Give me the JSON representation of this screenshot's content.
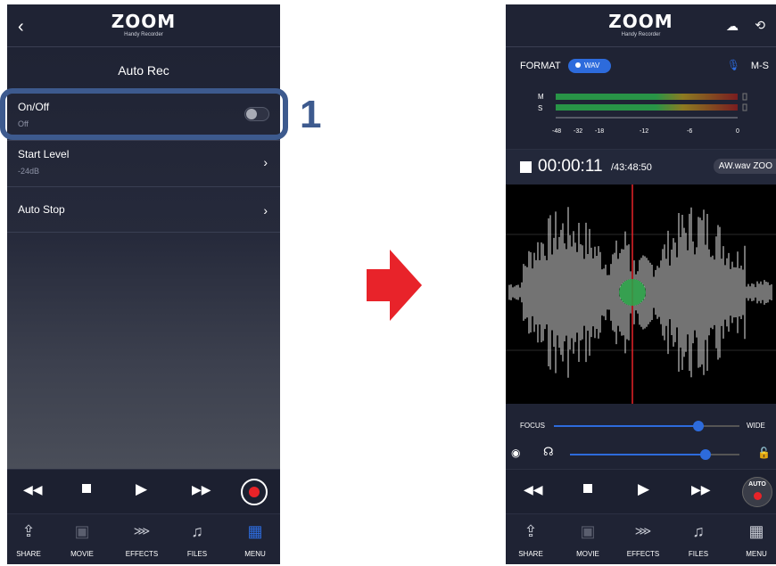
{
  "left": {
    "header": {
      "brand": "ZOOM",
      "subtitle": "Handy Recorder",
      "back": "‹"
    },
    "page_title": "Auto Rec",
    "rows": [
      {
        "label": "On/Off",
        "value": "Off"
      },
      {
        "label": "Start Level",
        "value": "-24dB"
      },
      {
        "label": "Auto Stop",
        "value": ""
      }
    ],
    "step": "1",
    "tabs": [
      "SHARE",
      "MOVIE",
      "EFFECTS",
      "FILES",
      "MENU"
    ]
  },
  "right": {
    "header": {
      "brand": "ZOOM",
      "subtitle": "Handy Recorder"
    },
    "format_label": "FORMAT",
    "format_value": "WAV",
    "mic_mode": "M-S",
    "meter_labels": [
      "M",
      "S"
    ],
    "meter_scale": [
      "-48",
      "-32",
      "-18",
      "-12",
      "-6",
      "0"
    ],
    "time": "00:00:11",
    "remaining": "/43:48:50",
    "filename": "AW.wav  ZOO",
    "focus_label": "FOCUS",
    "wide_label": "WIDE",
    "focus_level": 0.78,
    "volume_level": 0.8,
    "auto_label": "AUTO",
    "tabs": [
      "SHARE",
      "MOVIE",
      "EFFECTS",
      "FILES",
      "MENU"
    ]
  },
  "colors": {
    "accent": "#2d6bdc",
    "record": "#e82328",
    "arrow": "#e8232a",
    "highlight": "#3d5a8e"
  }
}
